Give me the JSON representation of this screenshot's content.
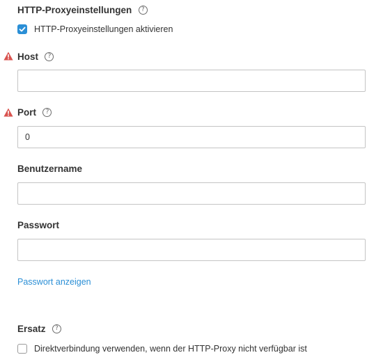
{
  "proxy": {
    "title": "HTTP-Proxyeinstellungen",
    "enable_label": "HTTP-Proxyeinstellungen aktivieren",
    "enabled": true
  },
  "host": {
    "label": "Host",
    "value": ""
  },
  "port": {
    "label": "Port",
    "value": "0"
  },
  "username": {
    "label": "Benutzername",
    "value": ""
  },
  "password": {
    "label": "Passwort",
    "value": ""
  },
  "show_password_link": "Passwort anzeigen",
  "fallback": {
    "title": "Ersatz",
    "direct_label": "Direktverbindung verwenden, wenn der HTTP-Proxy nicht verfügbar ist",
    "direct_checked": false
  },
  "icons": {
    "help": "help-circle-icon",
    "warning": "warning-triangle-icon",
    "check": "checkmark-icon"
  },
  "colors": {
    "accent": "#2b8fd6",
    "warning": "#d9534f",
    "border": "#c4c4c4"
  }
}
